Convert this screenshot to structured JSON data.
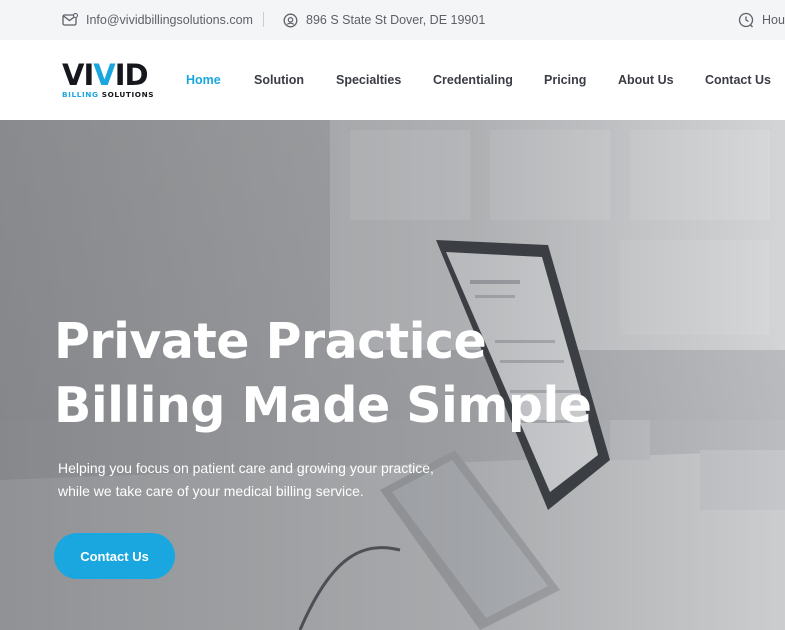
{
  "topbar": {
    "email": "Info@vividbillingsolutions.com",
    "address": "896 S State St Dover, DE 19901",
    "hours_label": "Hours",
    "icons": {
      "email": "mail-icon",
      "address": "location-pin-icon",
      "hours": "clock-icon"
    }
  },
  "logo": {
    "word_prefix": "VI",
    "word_accent": "V",
    "word_suffix": "ID",
    "sub_accent": "BILLING",
    "sub_rest": "SOLUTIONS"
  },
  "nav": {
    "items": [
      {
        "label": "Home",
        "active": true
      },
      {
        "label": "Solution",
        "active": false
      },
      {
        "label": "Specialties",
        "active": false
      },
      {
        "label": "Credentialing",
        "active": false
      },
      {
        "label": "Pricing",
        "active": false
      },
      {
        "label": "About Us",
        "active": false
      },
      {
        "label": "Contact Us",
        "active": false
      }
    ]
  },
  "hero": {
    "title_line1": "Private Practice",
    "title_line2": "Billing Made Simple",
    "text_line1": "Helping you focus on patient care and growing your practice,",
    "text_line2": "while we take care of your medical billing service.",
    "cta_label": "Contact Us"
  },
  "colors": {
    "accent": "#1aa7df",
    "topbar_bg": "#f4f5f7",
    "nav_text": "#3a3d44",
    "logo_dark": "#15171c"
  }
}
